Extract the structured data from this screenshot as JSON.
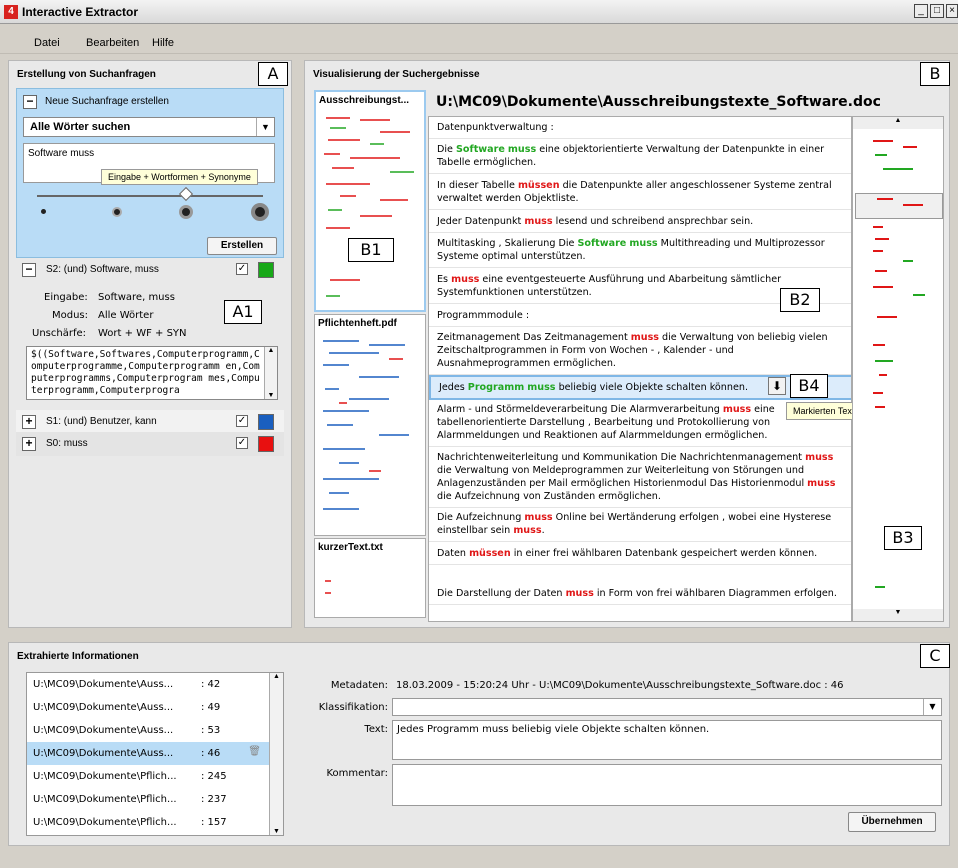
{
  "app": {
    "icon_label": "4",
    "title": "Interactive Extractor"
  },
  "menu": {
    "items": [
      "Datei",
      "Bearbeiten",
      "Hilfe"
    ]
  },
  "left_panel": {
    "title": "Erstellung von Suchanfragen",
    "label": "A",
    "new_query": {
      "expand": "−",
      "title": "Neue Suchanfrage erstellen",
      "mode": "Alle Wörter suchen",
      "input_value": "Software muss",
      "tooltip": "Eingabe + Wortformen + Synonyme",
      "slider_level": 3,
      "slider_steps": 4,
      "create_label": "Erstellen"
    },
    "queries": [
      {
        "toggle": "−",
        "label": "S2: (und) Software, muss",
        "checked": true,
        "color": "#18a818"
      },
      {
        "toggle": "+",
        "label": "S1: (und) Benutzer, kann",
        "checked": true,
        "color": "#1a5fbf"
      },
      {
        "toggle": "+",
        "label": "S0: muss",
        "checked": true,
        "color": "#e81010"
      }
    ],
    "details": [
      {
        "key": "Eingabe:",
        "value": "Software, muss"
      },
      {
        "key": "Modus:",
        "value": "Alle Wörter"
      },
      {
        "key": "Unschärfe:",
        "value": "Wort + WF + SYN"
      }
    ],
    "detail_label": "A1",
    "expression": "$((Software,Softwares,Computerprogramm,Computerprogramme,Computerprogramm en,Computerprogramms,Computerprogram mes,Computerprogramm,Computerprogra"
  },
  "right_panel": {
    "title": "Visualisierung der Suchergebnisse",
    "label": "B",
    "thumbnails": [
      {
        "title": "Ausschreibungst...",
        "label": "B1"
      },
      {
        "title": "Pflichtenheft.pdf"
      },
      {
        "title": "kurzerText.txt"
      }
    ],
    "doc_path": "U:\\MC09\\Dokumente\\Ausschreibungstexte_Software.doc",
    "doc_label": "B2",
    "extract_label": "B4",
    "extract_icon": "down-arrow-icon",
    "extract_tooltip": "Markierten Text extrahieren",
    "overview_label": "B3",
    "colors": {
      "green": "#22a722",
      "red": "#e01616",
      "blue": "#1a5fbf"
    }
  },
  "bottom_panel": {
    "title": "Extrahierte Informationen",
    "label": "C",
    "items": [
      {
        "path": "U:\\MC09\\Dokumente\\Auss...",
        "num": ": 42"
      },
      {
        "path": "U:\\MC09\\Dokumente\\Auss...",
        "num": ": 49"
      },
      {
        "path": "U:\\MC09\\Dokumente\\Auss...",
        "num": ": 53"
      },
      {
        "path": "U:\\MC09\\Dokumente\\Auss...",
        "num": ": 46"
      },
      {
        "path": "U:\\MC09\\Dokumente\\Pflich...",
        "num": ": 245"
      },
      {
        "path": "U:\\MC09\\Dokumente\\Pflich...",
        "num": ": 237"
      },
      {
        "path": "U:\\MC09\\Dokumente\\Pflich...",
        "num": ": 157"
      }
    ],
    "selected_index": 3,
    "metadata_label": "Metadaten:",
    "metadata_value": "18.03.2009 - 15:20:24 Uhr  -  U:\\MC09\\Dokumente\\Ausschreibungstexte_Software.doc : 46",
    "class_label": "Klassifikation:",
    "class_value": "",
    "text_label": "Text:",
    "text_value": "Jedes Programm muss beliebig viele Objekte schalten können.",
    "comment_label": "Kommentar:",
    "comment_value": "",
    "apply_label": "Übernehmen"
  }
}
